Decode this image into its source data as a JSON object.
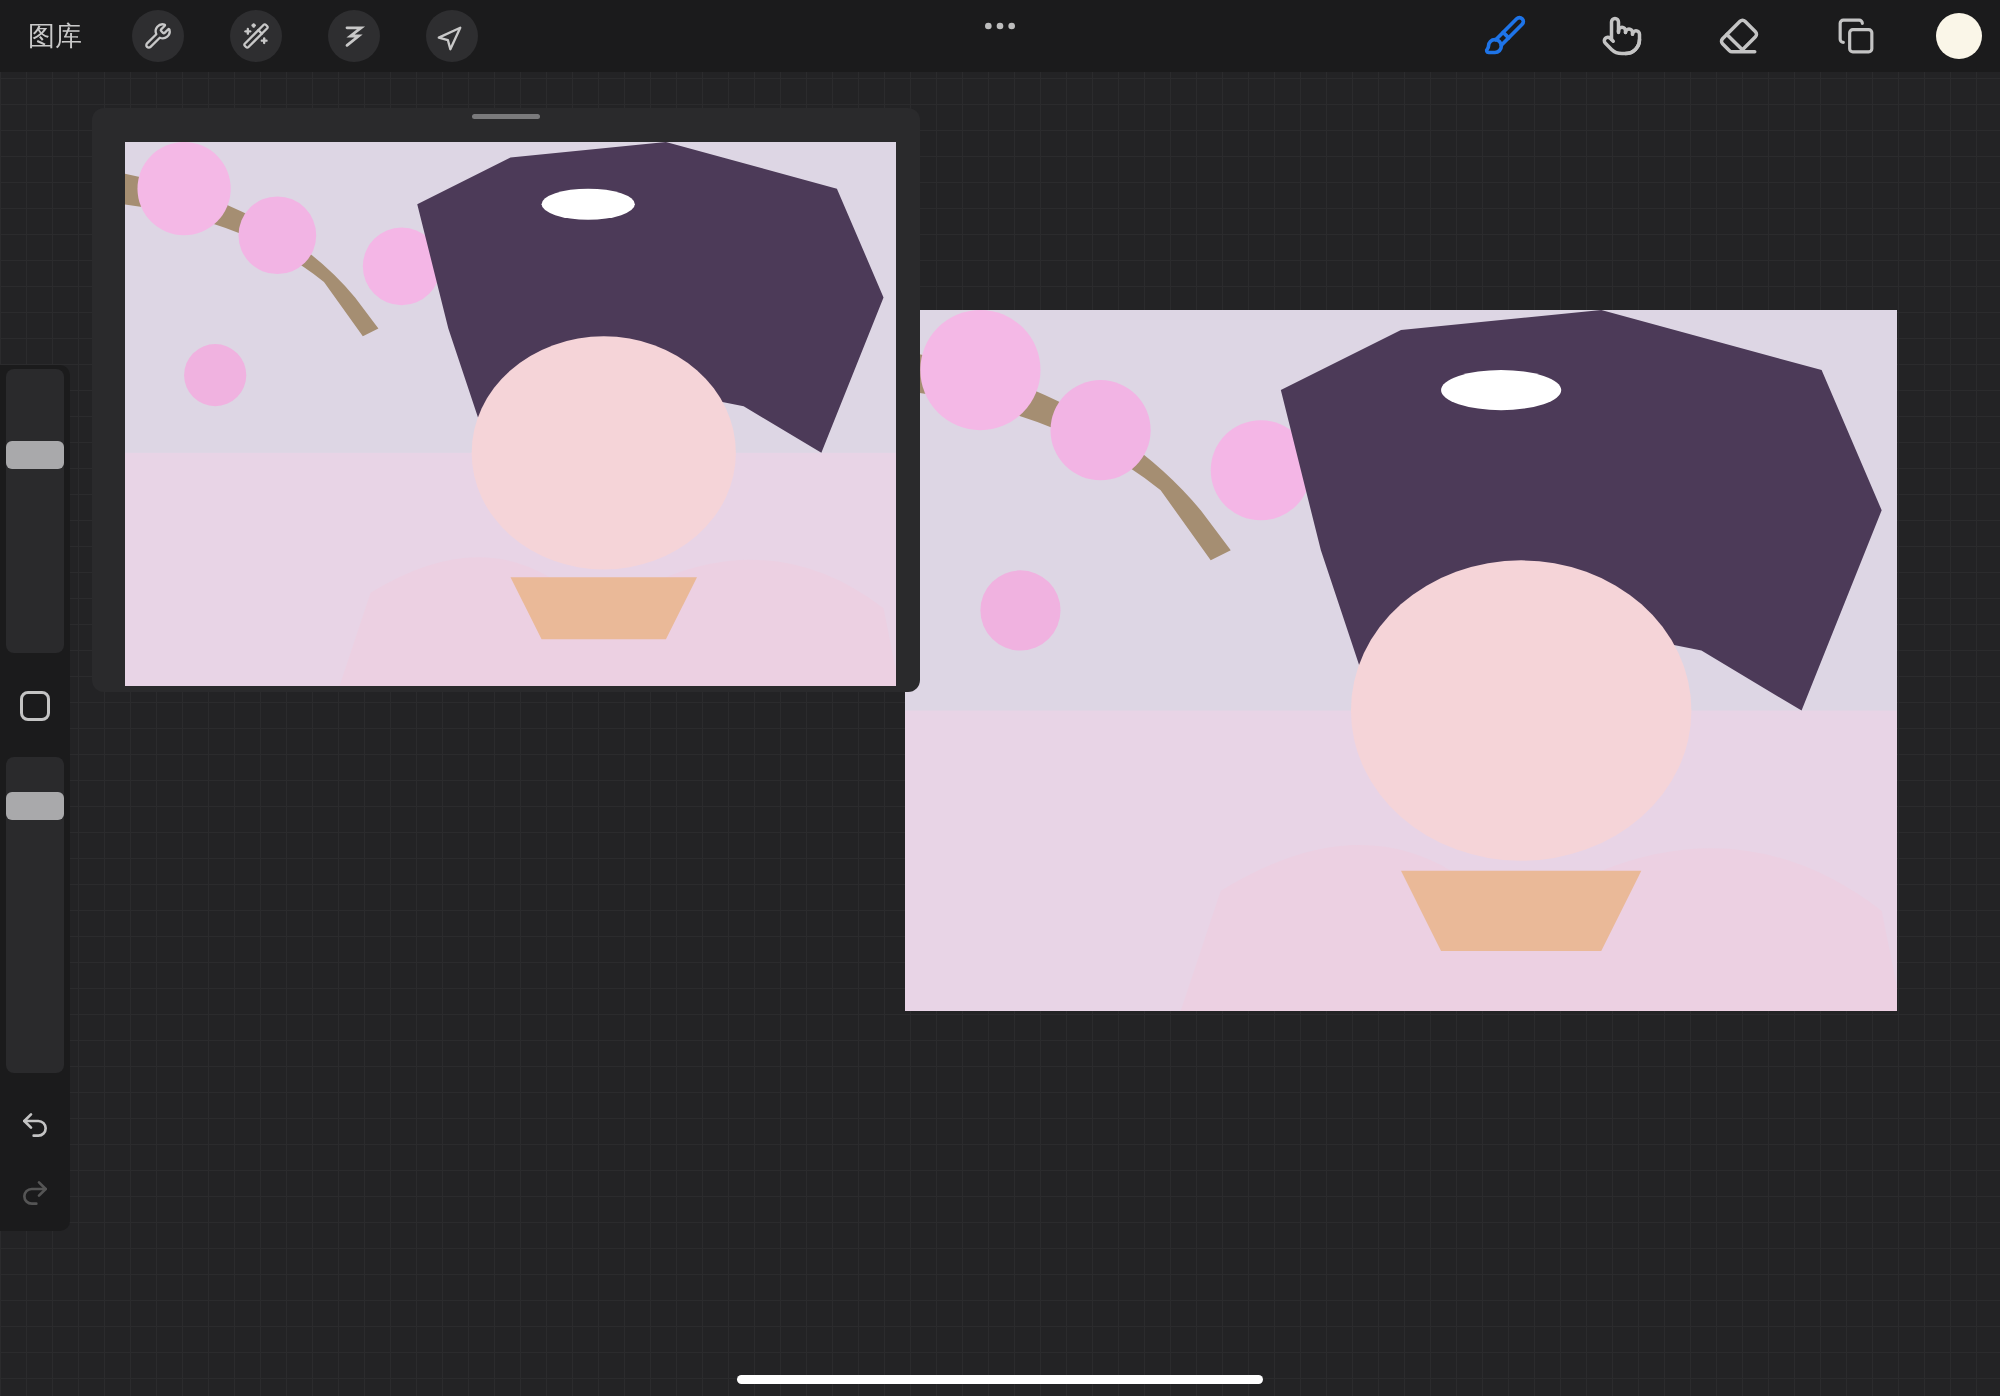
{
  "top_bar": {
    "gallery_label": "图库",
    "left_tools": [
      {
        "kind": "wrench"
      },
      {
        "kind": "wand"
      },
      {
        "kind": "selection"
      },
      {
        "kind": "transform"
      }
    ],
    "right_tools": [
      {
        "kind": "brush",
        "selected": true
      },
      {
        "kind": "smudge",
        "selected": false
      },
      {
        "kind": "eraser",
        "selected": false
      },
      {
        "kind": "layers",
        "selected": false
      }
    ]
  },
  "side_bar": {
    "brush_size": {
      "level": 0.72
    },
    "opacity": {
      "level": 0.88
    },
    "undo": {
      "disabled": false
    },
    "redo": {
      "disabled": true
    }
  }
}
